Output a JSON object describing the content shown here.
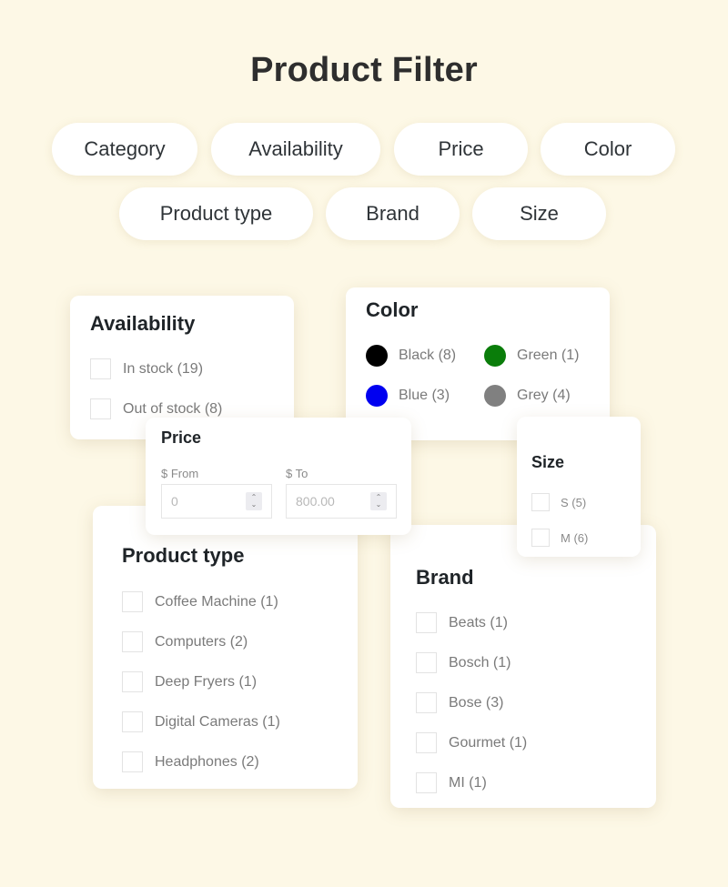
{
  "page": {
    "title": "Product Filter",
    "background_color": "#fdf8e6"
  },
  "filter_pills": [
    {
      "label": "Category"
    },
    {
      "label": "Availability"
    },
    {
      "label": "Price"
    },
    {
      "label": "Color"
    },
    {
      "label": "Product type"
    },
    {
      "label": "Brand"
    },
    {
      "label": "Size"
    }
  ],
  "availability": {
    "title": "Availability",
    "options": [
      {
        "label": "In stock (19)",
        "checked": false
      },
      {
        "label": "Out of stock (8)",
        "checked": false
      }
    ]
  },
  "color": {
    "title": "Color",
    "swatches": [
      {
        "label": "Black (8)",
        "hex": "#000000"
      },
      {
        "label": "Green (1)",
        "hex": "#0a7d0a"
      },
      {
        "label": "Blue (3)",
        "hex": "#0000f0"
      },
      {
        "label": "Grey (4)",
        "hex": "#808080"
      }
    ]
  },
  "price": {
    "title": "Price",
    "from_label": "$ From",
    "to_label": "$ To",
    "from_value": "0",
    "to_value": "800.00"
  },
  "size": {
    "title": "Size",
    "options": [
      {
        "label": "S (5)",
        "checked": false
      },
      {
        "label": "M (6)",
        "checked": false
      }
    ]
  },
  "product_type": {
    "title": "Product type",
    "options": [
      {
        "label": "Coffee Machine (1)",
        "checked": false
      },
      {
        "label": "Computers (2)",
        "checked": false
      },
      {
        "label": "Deep Fryers (1)",
        "checked": false
      },
      {
        "label": "Digital Cameras (1)",
        "checked": false
      },
      {
        "label": "Headphones (2)",
        "checked": false
      }
    ]
  },
  "brand": {
    "title": "Brand",
    "options": [
      {
        "label": "Beats (1)",
        "checked": false
      },
      {
        "label": "Bosch (1)",
        "checked": false
      },
      {
        "label": "Bose (3)",
        "checked": false
      },
      {
        "label": "Gourmet (1)",
        "checked": false
      },
      {
        "label": "MI (1)",
        "checked": false
      }
    ]
  },
  "icons": {
    "spinner_up": "⌃",
    "spinner_down": "⌄"
  }
}
